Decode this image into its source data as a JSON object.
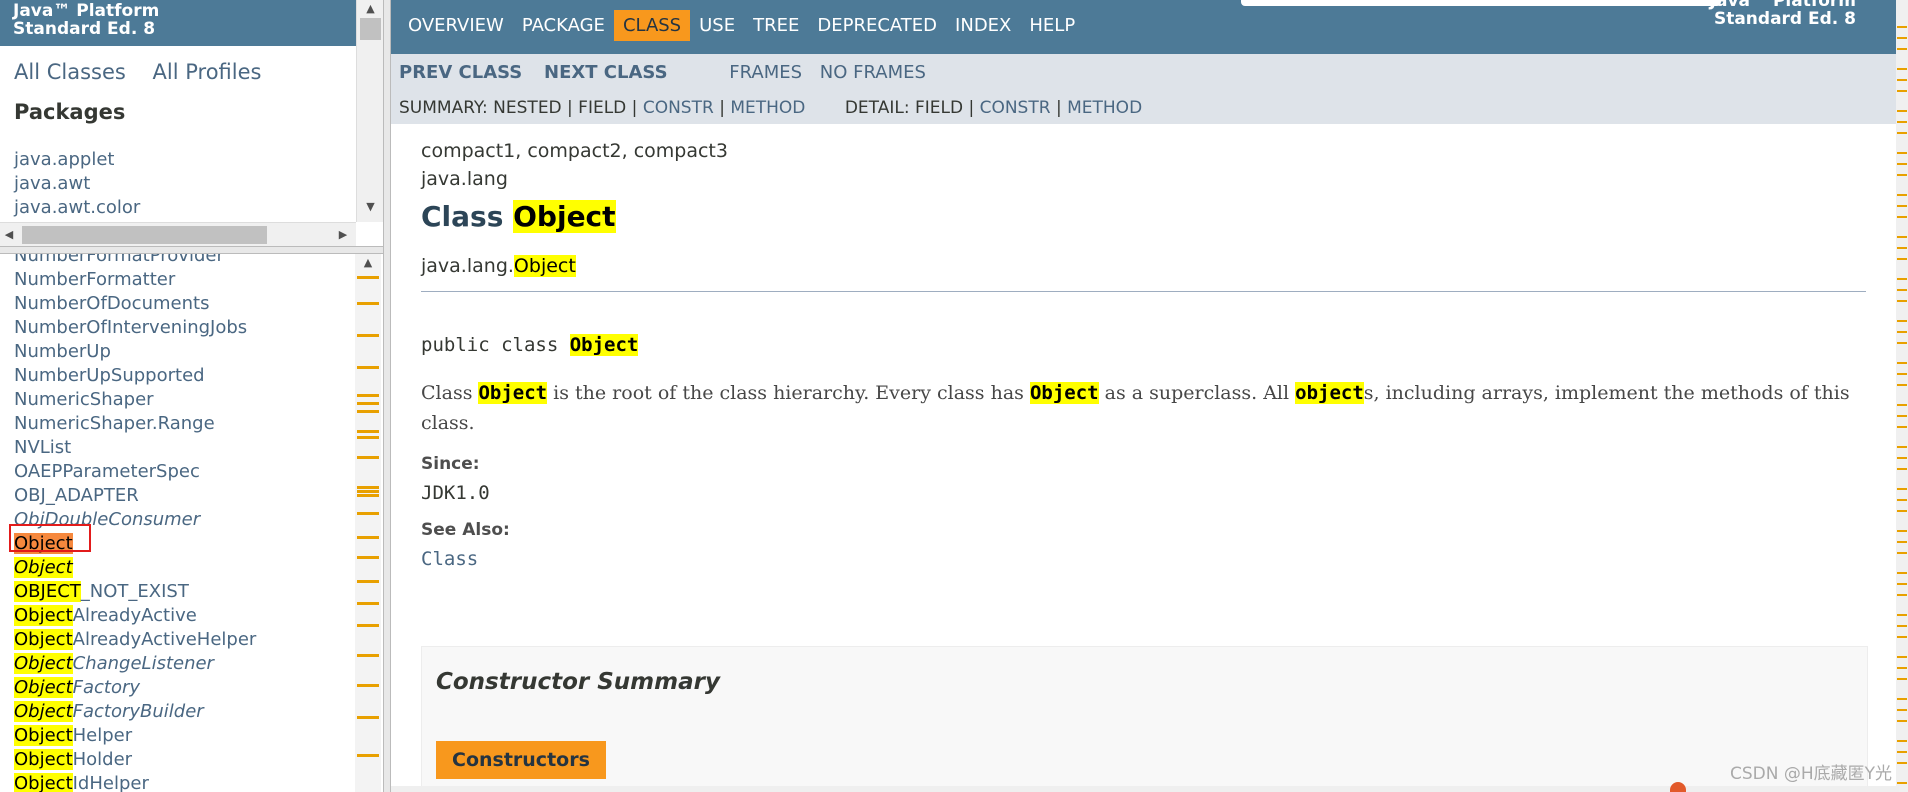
{
  "left_top": {
    "brand_line1": "Java™ Platform",
    "brand_line2": "Standard Ed. 8",
    "all_classes": "All Classes",
    "all_profiles": "All Profiles",
    "packages_heading": "Packages",
    "packages": [
      "java.applet",
      "java.awt",
      "java.awt.color"
    ]
  },
  "left_bottom": {
    "classes": [
      {
        "pre": "",
        "hl": "",
        "post": "NumberFormatProvider",
        "italic": false
      },
      {
        "pre": "",
        "hl": "",
        "post": "NumberFormatter",
        "italic": false
      },
      {
        "pre": "",
        "hl": "",
        "post": "NumberOfDocuments",
        "italic": false
      },
      {
        "pre": "",
        "hl": "",
        "post": "NumberOfInterveningJobs",
        "italic": false
      },
      {
        "pre": "",
        "hl": "",
        "post": "NumberUp",
        "italic": false
      },
      {
        "pre": "",
        "hl": "",
        "post": "NumberUpSupported",
        "italic": false
      },
      {
        "pre": "",
        "hl": "",
        "post": "NumericShaper",
        "italic": false
      },
      {
        "pre": "",
        "hl": "",
        "post": "NumericShaper.Range",
        "italic": false
      },
      {
        "pre": "",
        "hl": "",
        "post": "NVList",
        "italic": false
      },
      {
        "pre": "",
        "hl": "",
        "post": "OAEPParameterSpec",
        "italic": false
      },
      {
        "pre": "",
        "hl": "",
        "post": "OBJ_ADAPTER",
        "italic": false
      },
      {
        "pre": "",
        "hl": "",
        "post": "ObjDoubleConsumer",
        "italic": true
      },
      {
        "pre": "",
        "hl": "Object",
        "post": "",
        "italic": false,
        "selected": true
      },
      {
        "pre": "",
        "hl": "Object",
        "post": "",
        "italic": true
      },
      {
        "pre": "",
        "hl": "OBJECT",
        "post": "_NOT_EXIST",
        "italic": false
      },
      {
        "pre": "",
        "hl": "Object",
        "post": "AlreadyActive",
        "italic": false
      },
      {
        "pre": "",
        "hl": "Object",
        "post": "AlreadyActiveHelper",
        "italic": false
      },
      {
        "pre": "",
        "hl": "Object",
        "post": "ChangeListener",
        "italic": true
      },
      {
        "pre": "",
        "hl": "Object",
        "post": "Factory",
        "italic": true
      },
      {
        "pre": "",
        "hl": "Object",
        "post": "FactoryBuilder",
        "italic": true
      },
      {
        "pre": "",
        "hl": "Object",
        "post": "Helper",
        "italic": false
      },
      {
        "pre": "",
        "hl": "Object",
        "post": "Holder",
        "italic": false
      },
      {
        "pre": "",
        "hl": "Object",
        "post": "IdHelper",
        "italic": false
      }
    ]
  },
  "topnav": {
    "items": [
      "OVERVIEW",
      "PACKAGE",
      "CLASS",
      "USE",
      "TREE",
      "DEPRECATED",
      "INDEX",
      "HELP"
    ],
    "active": "CLASS",
    "brand_line1": "Java™ Platform",
    "brand_line2": "Standard Ed. 8"
  },
  "subnav": {
    "prev_class": "PREV CLASS",
    "next_class": "NEXT CLASS",
    "frames": "FRAMES",
    "no_frames": "NO FRAMES",
    "summary_label": "SUMMARY: NESTED | FIELD |",
    "summary_constr": "CONSTR",
    "summary_method": "METHOD",
    "detail_label": "DETAIL: FIELD |",
    "detail_constr": "CONSTR",
    "detail_method": "METHOD",
    "sep": "|"
  },
  "content": {
    "profiles": "compact1, compact2, compact3",
    "package": "java.lang",
    "title_prefix": "Class ",
    "title_name": "Object",
    "inherit_prefix": "java.lang.",
    "inherit_name": "Object",
    "signature_prefix": "public class ",
    "signature_name": "Object",
    "desc_1": "Class ",
    "desc_2": "Object",
    "desc_3": " is the root of the class hierarchy. Every class has ",
    "desc_4": "Object",
    "desc_5": " as a superclass. All ",
    "desc_6": "object",
    "desc_7": "s, including arrays, implement the methods of this class.",
    "since_label": "Since:",
    "since_value": "JDK1.0",
    "see_also_label": "See Also:",
    "see_also_value": "Class",
    "constructor_summary": "Constructor Summary",
    "constructors_tab": "Constructors"
  },
  "watermark": "CSDN @H底藏匿Y光",
  "colors": {
    "header_bg": "#4d7a97",
    "subnav_bg": "#dee3e9",
    "active_tab": "#f8981d",
    "highlight": "#ffff00",
    "selected_bg": "#f6883d",
    "selection_box": "#e21b1b"
  }
}
